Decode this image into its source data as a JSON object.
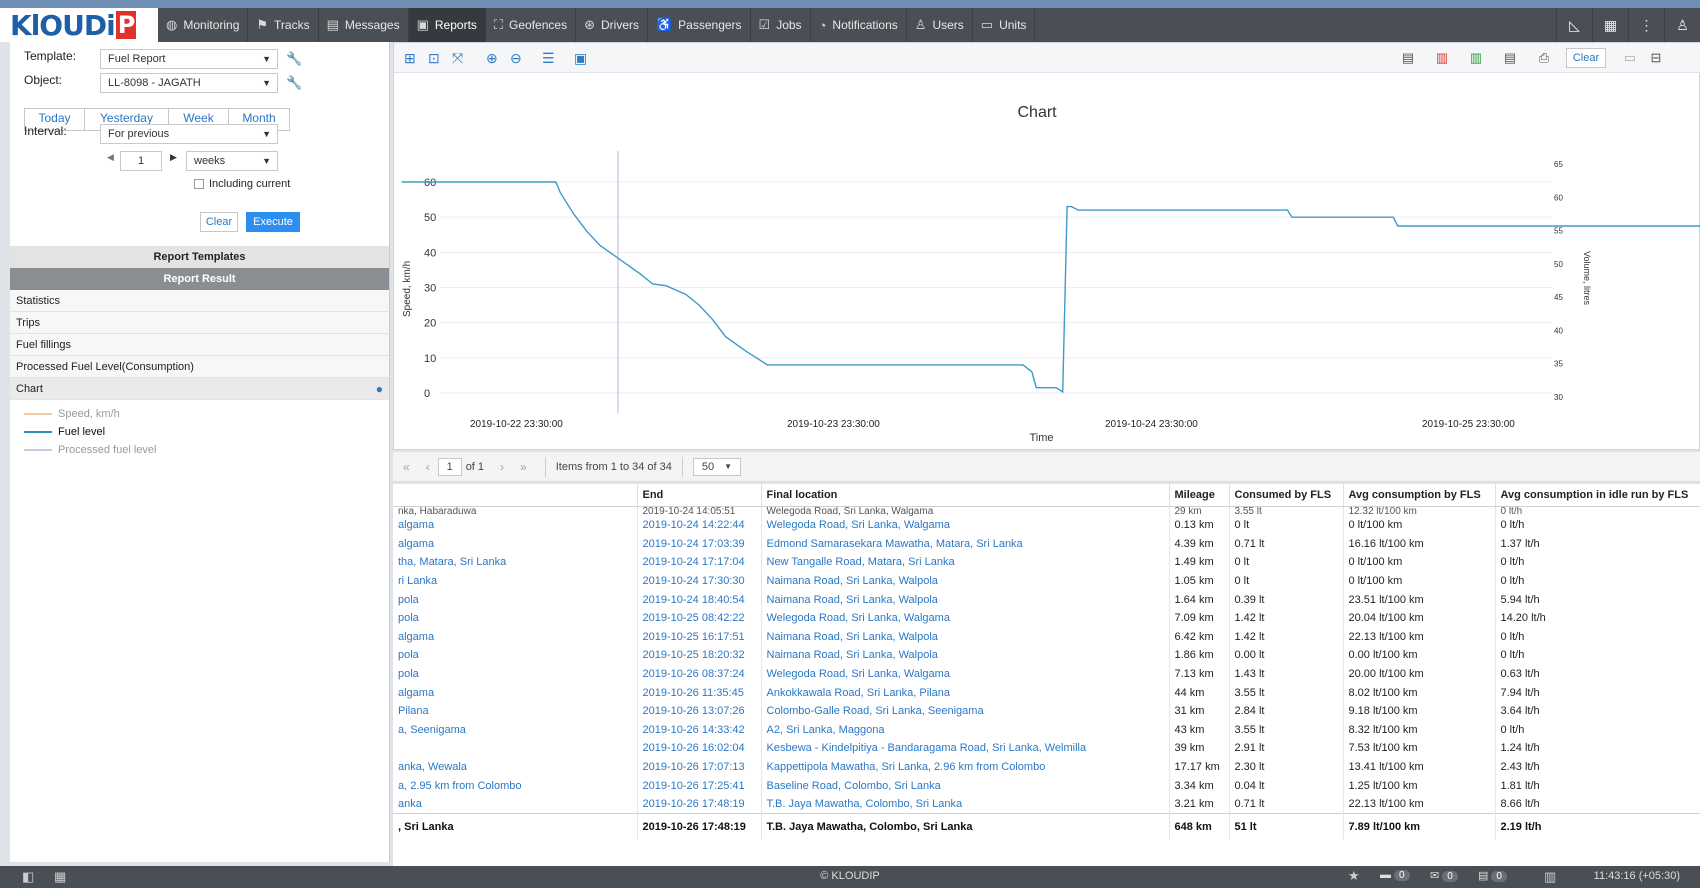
{
  "app": {
    "logo_main": "KlOUDi",
    "logo_accent": "P"
  },
  "nav": {
    "items": [
      {
        "label": "Monitoring",
        "icon": "globe-icon"
      },
      {
        "label": "Tracks",
        "icon": "tracks-icon"
      },
      {
        "label": "Messages",
        "icon": "messages-icon"
      },
      {
        "label": "Reports",
        "icon": "reports-icon",
        "active": true
      },
      {
        "label": "Geofences",
        "icon": "geofence-icon"
      },
      {
        "label": "Drivers",
        "icon": "steering-wheel-icon"
      },
      {
        "label": "Passengers",
        "icon": "passenger-icon"
      },
      {
        "label": "Jobs",
        "icon": "jobs-icon"
      },
      {
        "label": "Notifications",
        "icon": "bell-icon"
      },
      {
        "label": "Users",
        "icon": "user-icon"
      },
      {
        "label": "Units",
        "icon": "bus-icon"
      }
    ]
  },
  "form": {
    "template_label": "Template:",
    "template_value": "Fuel Report",
    "object_label": "Object:",
    "object_value": "LL-8098 - JAGATH",
    "quick": [
      "Today",
      "Yesterday",
      "Week",
      "Month"
    ],
    "interval_label": "Interval:",
    "interval_value": "For previous",
    "count_value": "1",
    "unit_value": "weeks",
    "including_current": "Including current",
    "clear": "Clear",
    "execute": "Execute"
  },
  "left": {
    "templates_header": "Report Templates",
    "result_header": "Report Result",
    "result_items": [
      "Statistics",
      "Trips",
      "Fuel fillings",
      "Processed Fuel Level(Consumption)",
      "Chart"
    ],
    "legend": [
      {
        "label": "Speed, km/h",
        "color": "#f3b27a",
        "active": false
      },
      {
        "label": "Fuel level",
        "color": "#2f8fc1",
        "active": true
      },
      {
        "label": "Processed fuel level",
        "color": "#9fb3cf",
        "active": false
      }
    ]
  },
  "chart_toolbar": {
    "clear": "Clear"
  },
  "chart_data": {
    "type": "line",
    "title": "Chart",
    "xlabel": "Time",
    "ylabel": "Speed, km/h",
    "y2label": "Volume, litres",
    "x_ticks": [
      "2019-10-22 23:30:00",
      "2019-10-23 23:30:00",
      "2019-10-24 23:30:00",
      "2019-10-25 23:30:00"
    ],
    "y_ticks": [
      0,
      10,
      20,
      30,
      40,
      50,
      60
    ],
    "y2_ticks": [
      30,
      35,
      40,
      45,
      50,
      55,
      60,
      65
    ],
    "ylim": [
      0,
      65
    ],
    "y2lim": [
      29,
      66
    ],
    "grid": true,
    "series": [
      {
        "name": "Fuel level",
        "color": "#3d9ac9",
        "points": [
          [
            "2019-10-22 15:00",
            60
          ],
          [
            "2019-10-23 02:40",
            60
          ],
          [
            "2019-10-23 03:00",
            57
          ],
          [
            "2019-10-23 04:00",
            51
          ],
          [
            "2019-10-23 05:00",
            46
          ],
          [
            "2019-10-23 06:00",
            42
          ],
          [
            "2019-10-23 07:30",
            38
          ],
          [
            "2019-10-23 09:00",
            34
          ],
          [
            "2019-10-23 10:00",
            31
          ],
          [
            "2019-10-23 11:00",
            30.5
          ],
          [
            "2019-10-23 12:30",
            28
          ],
          [
            "2019-10-23 13:30",
            25
          ],
          [
            "2019-10-23 14:30",
            21
          ],
          [
            "2019-10-23 15:30",
            16
          ],
          [
            "2019-10-23 17:00",
            12
          ],
          [
            "2019-10-23 18:40",
            8
          ],
          [
            "2019-10-24 14:00",
            8
          ],
          [
            "2019-10-24 14:40",
            6
          ],
          [
            "2019-10-24 15:00",
            1.5
          ],
          [
            "2019-10-24 16:30",
            1.5
          ],
          [
            "2019-10-24 17:00",
            0.3
          ],
          [
            "2019-10-24 17:20",
            53
          ],
          [
            "2019-10-24 17:40",
            53
          ],
          [
            "2019-10-24 18:10",
            52
          ],
          [
            "2019-10-25 10:00",
            52
          ],
          [
            "2019-10-25 10:20",
            50
          ],
          [
            "2019-10-25 18:00",
            50
          ],
          [
            "2019-10-25 18:20",
            47.5
          ],
          [
            "2019-10-26 17:48",
            47.5
          ]
        ]
      }
    ]
  },
  "pager": {
    "page": "1",
    "of": "of 1",
    "items": "Items from 1 to 34 of 34",
    "per_page": "50"
  },
  "table": {
    "columns": [
      "",
      "End",
      "Final location",
      "Mileage",
      "Consumed by FLS",
      "Avg consumption by FLS",
      "Avg consumption in idle run by FLS"
    ],
    "partial_row": [
      "nka, Habaraduwa",
      "2019-10-24 14:05:51",
      "Welegoda Road, Sri Lanka, Walgama",
      "29 km",
      "3.55 lt",
      "12.32 lt/100 km",
      "0 lt/h"
    ],
    "rows": [
      [
        "algama",
        "2019-10-24 14:22:44",
        "Welegoda Road, Sri Lanka, Walgama",
        "0.13 km",
        "0 lt",
        "0 lt/100 km",
        "0 lt/h"
      ],
      [
        "algama",
        "2019-10-24 17:03:39",
        "Edmond Samarasekara Mawatha, Matara, Sri Lanka",
        "4.39 km",
        "0.71 lt",
        "16.16 lt/100 km",
        "1.37 lt/h"
      ],
      [
        "tha, Matara, Sri Lanka",
        "2019-10-24 17:17:04",
        "New Tangalle Road, Matara, Sri Lanka",
        "1.49 km",
        "0 lt",
        "0 lt/100 km",
        "0 lt/h"
      ],
      [
        "ri Lanka",
        "2019-10-24 17:30:30",
        "Naimana Road, Sri Lanka, Walpola",
        "1.05 km",
        "0 lt",
        "0 lt/100 km",
        "0 lt/h"
      ],
      [
        "pola",
        "2019-10-24 18:40:54",
        "Naimana Road, Sri Lanka, Walpola",
        "1.64 km",
        "0.39 lt",
        "23.51 lt/100 km",
        "5.94 lt/h"
      ],
      [
        "pola",
        "2019-10-25 08:42:22",
        "Welegoda Road, Sri Lanka, Walgama",
        "7.09 km",
        "1.42 lt",
        "20.04 lt/100 km",
        "14.20 lt/h"
      ],
      [
        "algama",
        "2019-10-25 16:17:51",
        "Naimana Road, Sri Lanka, Walpola",
        "6.42 km",
        "1.42 lt",
        "22.13 lt/100 km",
        "0 lt/h"
      ],
      [
        "pola",
        "2019-10-25 18:20:32",
        "Naimana Road, Sri Lanka, Walpola",
        "1.86 km",
        "0.00 lt",
        "0.00 lt/100 km",
        "0 lt/h"
      ],
      [
        "pola",
        "2019-10-26 08:37:24",
        "Welegoda Road, Sri Lanka, Walgama",
        "7.13 km",
        "1.43 lt",
        "20.00 lt/100 km",
        "0.63 lt/h"
      ],
      [
        "algama",
        "2019-10-26 11:35:45",
        "Ankokkawala Road, Sri Lanka, Pilana",
        "44 km",
        "3.55 lt",
        "8.02 lt/100 km",
        "7.94 lt/h"
      ],
      [
        " Pilana",
        "2019-10-26 13:07:26",
        "Colombo-Galle Road, Sri Lanka, Seenigama",
        "31 km",
        "2.84 lt",
        "9.18 lt/100 km",
        "3.64 lt/h"
      ],
      [
        "a, Seenigama",
        "2019-10-26 14:33:42",
        "A2, Sri Lanka, Maggona",
        "43 km",
        "3.55 lt",
        "8.32 lt/100 km",
        "0 lt/h"
      ],
      [
        "",
        "2019-10-26 16:02:04",
        "Kesbewa - Kindelpitiya - Bandaragama Road, Sri Lanka, Welmilla",
        "39 km",
        "2.91 lt",
        "7.53 lt/100 km",
        "1.24 lt/h"
      ],
      [
        "anka, Wewala",
        "2019-10-26 17:07:13",
        "Kappettipola Mawatha, Sri Lanka, 2.96 km from Colombo",
        "17.17 km",
        "2.30 lt",
        "13.41 lt/100 km",
        "2.43 lt/h"
      ],
      [
        "a, 2.95 km from Colombo",
        "2019-10-26 17:25:41",
        "Baseline Road, Colombo, Sri Lanka",
        "3.34 km",
        "0.04 lt",
        "1.25 lt/100 km",
        "1.81 lt/h"
      ],
      [
        "anka",
        "2019-10-26 17:48:19",
        "T.B. Jaya Mawatha, Colombo, Sri Lanka",
        "3.21 km",
        "0.71 lt",
        "22.13 lt/100 km",
        "8.66 lt/h"
      ]
    ],
    "total": [
      ", Sri Lanka",
      "2019-10-26 17:48:19",
      "T.B. Jaya Mawatha, Colombo, Sri Lanka",
      "648 km",
      "51 lt",
      "7.89 lt/100 km",
      "2.19 lt/h"
    ]
  },
  "footer": {
    "copyright": "© KLOUDIP",
    "badges": [
      "0",
      "0",
      "0"
    ],
    "time": "11:43:16 (+05:30)"
  }
}
